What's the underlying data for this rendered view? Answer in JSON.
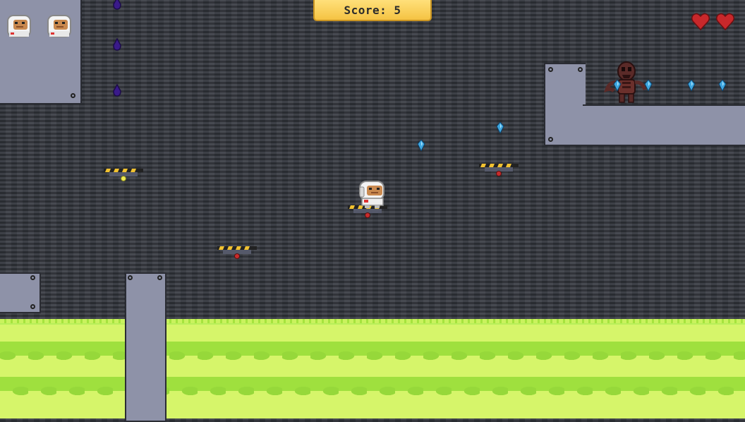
{
  "hud": {
    "score_label": "Score: 5",
    "lives_remaining": 2,
    "hearts": 2
  },
  "colors": {
    "panel": "#8e92a8",
    "background": "#3a3d44",
    "acid": "#d6f56a",
    "score_banner": "#f5c343",
    "heart": "#c8282b",
    "gem": "#3fa7e0",
    "drop": "#3a1a8a"
  },
  "icons": {
    "life": "astronaut-head-icon",
    "heart": "heart-icon",
    "gem": "blue-crystal-icon",
    "drop": "purple-drip-icon",
    "player": "astronaut-player-icon",
    "enemy": "alien-monster-icon",
    "platform": "hover-platform-icon"
  }
}
